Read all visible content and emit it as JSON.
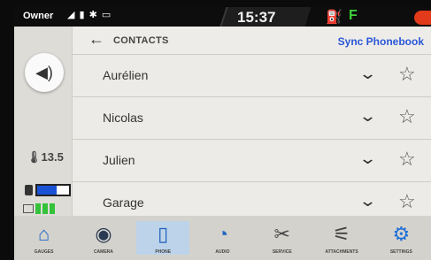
{
  "status": {
    "profile": "Owner",
    "icons_text": "◢ ▮ ✱ ▭",
    "time": "15:37",
    "gear": "F"
  },
  "left": {
    "temperature": "13.5",
    "battery_level": 0.62
  },
  "header": {
    "back_symbol": "←",
    "title": "CONTACTS",
    "sync_label": "Sync Phonebook"
  },
  "contacts": [
    {
      "name": "Aurélien"
    },
    {
      "name": "Nicolas"
    },
    {
      "name": "Julien"
    },
    {
      "name": "Garage"
    }
  ],
  "apps": [
    {
      "label": "Gauges",
      "icon": "house-icon",
      "glyph": "⌂"
    },
    {
      "label": "Camera",
      "icon": "camera-icon",
      "glyph": "◉"
    },
    {
      "label": "Phone",
      "icon": "phone-icon",
      "glyph": "▯"
    },
    {
      "label": "Audio",
      "icon": "speaker-icon",
      "glyph": "◔"
    },
    {
      "label": "Service",
      "icon": "tools-icon",
      "glyph": "✂"
    },
    {
      "label": "Attachments",
      "icon": "attachment-icon",
      "glyph": "⚟"
    },
    {
      "label": "Settings",
      "icon": "gear-icon",
      "glyph": "⚙"
    }
  ],
  "colors": {
    "accent": "#2a58d8",
    "gear": "#3ed038",
    "battery": "#1a52d6",
    "charge": "#33c23a",
    "alert": "#e23a1a"
  }
}
